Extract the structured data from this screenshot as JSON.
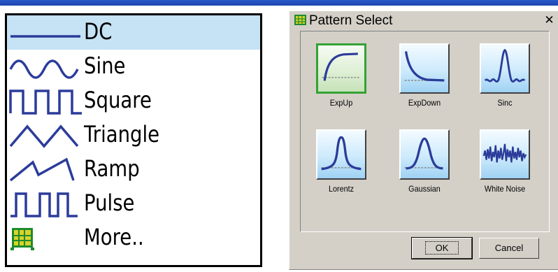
{
  "waveform_menu": {
    "items": [
      {
        "label": "DC",
        "icon": "dc-wave-icon",
        "selected": true
      },
      {
        "label": "Sine",
        "icon": "sine-wave-icon"
      },
      {
        "label": "Square",
        "icon": "square-wave-icon"
      },
      {
        "label": "Triangle",
        "icon": "triangle-wave-icon"
      },
      {
        "label": "Ramp",
        "icon": "ramp-wave-icon"
      },
      {
        "label": "Pulse",
        "icon": "pulse-wave-icon"
      },
      {
        "label": "More..",
        "icon": "more-patterns-icon"
      }
    ],
    "highlight_color": "#c6e2f5",
    "wave_color": "#2b3c9a"
  },
  "pattern_dialog": {
    "title": "Pattern Select",
    "close_glyph": "✕",
    "patterns": [
      {
        "label": "ExpUp",
        "selected": true
      },
      {
        "label": "ExpDown"
      },
      {
        "label": "Sinc"
      },
      {
        "label": "Lorentz"
      },
      {
        "label": "Gaussian"
      },
      {
        "label": "White Noise"
      }
    ],
    "ok_label": "OK",
    "cancel_label": "Cancel",
    "selected_border_color": "#34a234"
  }
}
